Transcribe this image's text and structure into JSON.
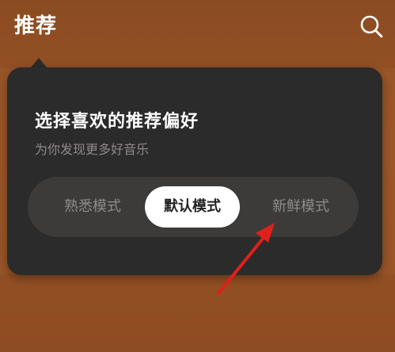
{
  "header": {
    "title": "推荐",
    "search_icon": "search-icon"
  },
  "popup": {
    "title": "选择喜欢的推荐偏好",
    "subtitle": "为你发现更多好音乐",
    "modes": [
      {
        "label": "熟悉模式",
        "selected": false
      },
      {
        "label": "默认模式",
        "selected": true
      },
      {
        "label": "新鲜模式",
        "selected": false
      }
    ]
  },
  "colors": {
    "background": "#8a4a21",
    "popup": "#2c2b2b",
    "annotation_arrow": "#e0201a"
  }
}
